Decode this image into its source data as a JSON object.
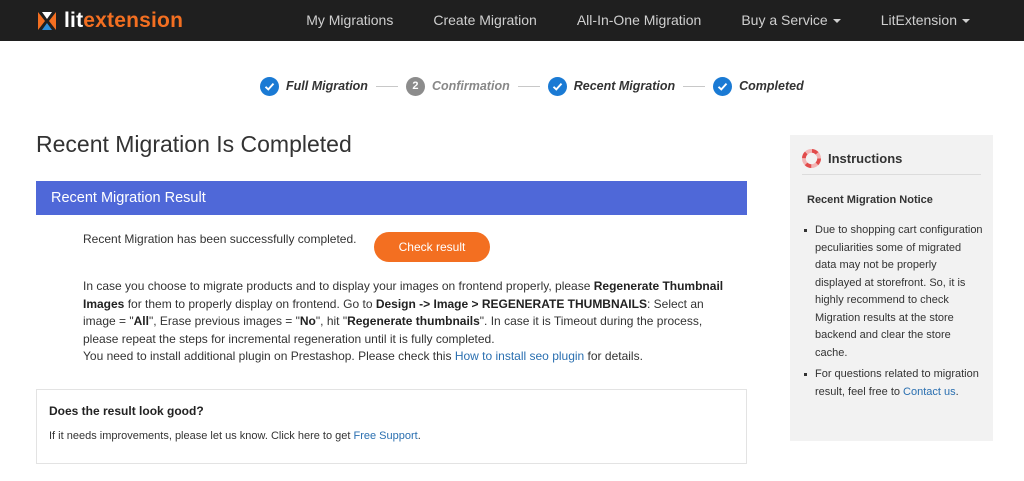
{
  "brand": {
    "lit": "lit",
    "extension": "extension",
    "accent": "#f36f21"
  },
  "nav": {
    "items": [
      {
        "label": "My Migrations",
        "has_dropdown": false
      },
      {
        "label": "Create Migration",
        "has_dropdown": false
      },
      {
        "label": "All-In-One Migration",
        "has_dropdown": false
      },
      {
        "label": "Buy a Service",
        "has_dropdown": true
      },
      {
        "label": "LitExtension",
        "has_dropdown": true
      }
    ]
  },
  "stepper": {
    "steps": [
      {
        "label": "Full Migration",
        "state": "done",
        "number": ""
      },
      {
        "label": "Confirmation",
        "state": "pending",
        "number": "2"
      },
      {
        "label": "Recent Migration",
        "state": "done",
        "number": ""
      },
      {
        "label": "Completed",
        "state": "done",
        "number": ""
      }
    ]
  },
  "page": {
    "title": "Recent Migration Is Completed"
  },
  "result": {
    "header": "Recent Migration Result",
    "success_text": "Recent Migration has been successfully completed.",
    "check_button": "Check result",
    "note": {
      "p1_a": "In case you choose to migrate products and to display your images on frontend properly, please ",
      "p1_b": "Regenerate Thumbnail Images",
      "p1_c": " for them to properly display on frontend. Go to ",
      "p1_d": "Design -> Image > REGENERATE THUMBNAILS",
      "p1_e": ": Select an image = \"",
      "p1_f": "All",
      "p1_g": "\", Erase previous images = \"",
      "p1_h": "No",
      "p1_i": "\", hit \"",
      "p1_j": "Regenerate thumbnails",
      "p1_k": "\". In case it is Timeout during the process, please repeat the steps for incremental regeneration until it is fully completed.",
      "p2_a": "You need to install additional plugin on Prestashop. Please check this ",
      "p2_link": "How to install seo plugin",
      "p2_b": " for details."
    }
  },
  "feedback": {
    "title": "Does the result look good?",
    "text": "If it needs improvements, please let us know. Click here to get ",
    "link": "Free Support",
    "suffix": "."
  },
  "sidebar": {
    "title": "Instructions",
    "subtitle": "Recent Migration Notice",
    "item1": "Due to shopping cart configuration peculiarities some of migrated data may not be properly displayed at storefront. So, it is highly recommend to check Migration results at the store backend and clear the store cache.",
    "item2_text": "For questions related to migration result, feel free to ",
    "item2_link": "Contact us",
    "item2_suffix": "."
  },
  "colors": {
    "navbar": "#1f1f1f",
    "header_blue": "#4f68d8",
    "step_blue": "#1a7ad4",
    "button_orange": "#f36f21",
    "link": "#2a6fb0"
  }
}
